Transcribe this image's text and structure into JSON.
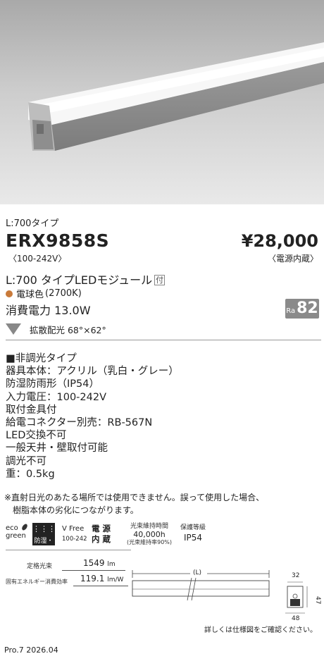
{
  "header": {
    "type_label": "L:700タイプ",
    "model": "ERX9858S",
    "voltage": "〈100-242V〉",
    "price": "¥28,000",
    "price_note": "〈電源内蔵〉"
  },
  "product": {
    "title": "L:700 タイプLEDモジュール",
    "tsuki": "付",
    "color": "電球色",
    "color_temp": "(2700K)",
    "color_dot": "#c97a3a",
    "power": "消費電力 13.0W",
    "ra_label": "Ra",
    "ra_value": "82",
    "beam": "拡散配光 68°×62°"
  },
  "specs": [
    "■非調光タイプ",
    "器具本体：アクリル（乳白・グレー）",
    "防湿防雨形（IP54）",
    "入力電圧：100-242V",
    "取付金具付",
    "給電コネクター別売：RB-567N",
    "LED交換不可",
    "一般天井・壁取付可能",
    "調光不可",
    "重：0.5kg"
  ],
  "notes": [
    "※直射日光のあたる場所では使用できません。誤って使用した場合、",
    "樹脂本体の劣化につながります。"
  ],
  "icons": {
    "eco_1": "eco",
    "eco_2": "green",
    "waterproof": "防湿・雨",
    "vfree": "V Free",
    "vfree_range": "100-242",
    "power_1": "電 源",
    "power_2": "内 蔵",
    "life_title": "光束維持時間",
    "life_value": "40,000h",
    "life_note": "(光束維持率90%)",
    "ip_title": "保護等級",
    "ip_value": "IP54"
  },
  "performance": {
    "flux_label": "定格光束",
    "flux_value": "1549",
    "flux_unit": "lm",
    "eff_label": "固有エネルギー消費効率",
    "eff_value": "119.1",
    "eff_unit": "lm/W"
  },
  "drawing": {
    "length_label": "(L)",
    "dim_top": "32",
    "dim_side": "47",
    "dim_bottom": "48",
    "note": "詳しくは仕様図をご確認ください。"
  },
  "footer": "Pro.7 2026.04",
  "colors": {
    "badge_gray": "#8a8a8a",
    "photo_bg": "#d6d6d6"
  }
}
